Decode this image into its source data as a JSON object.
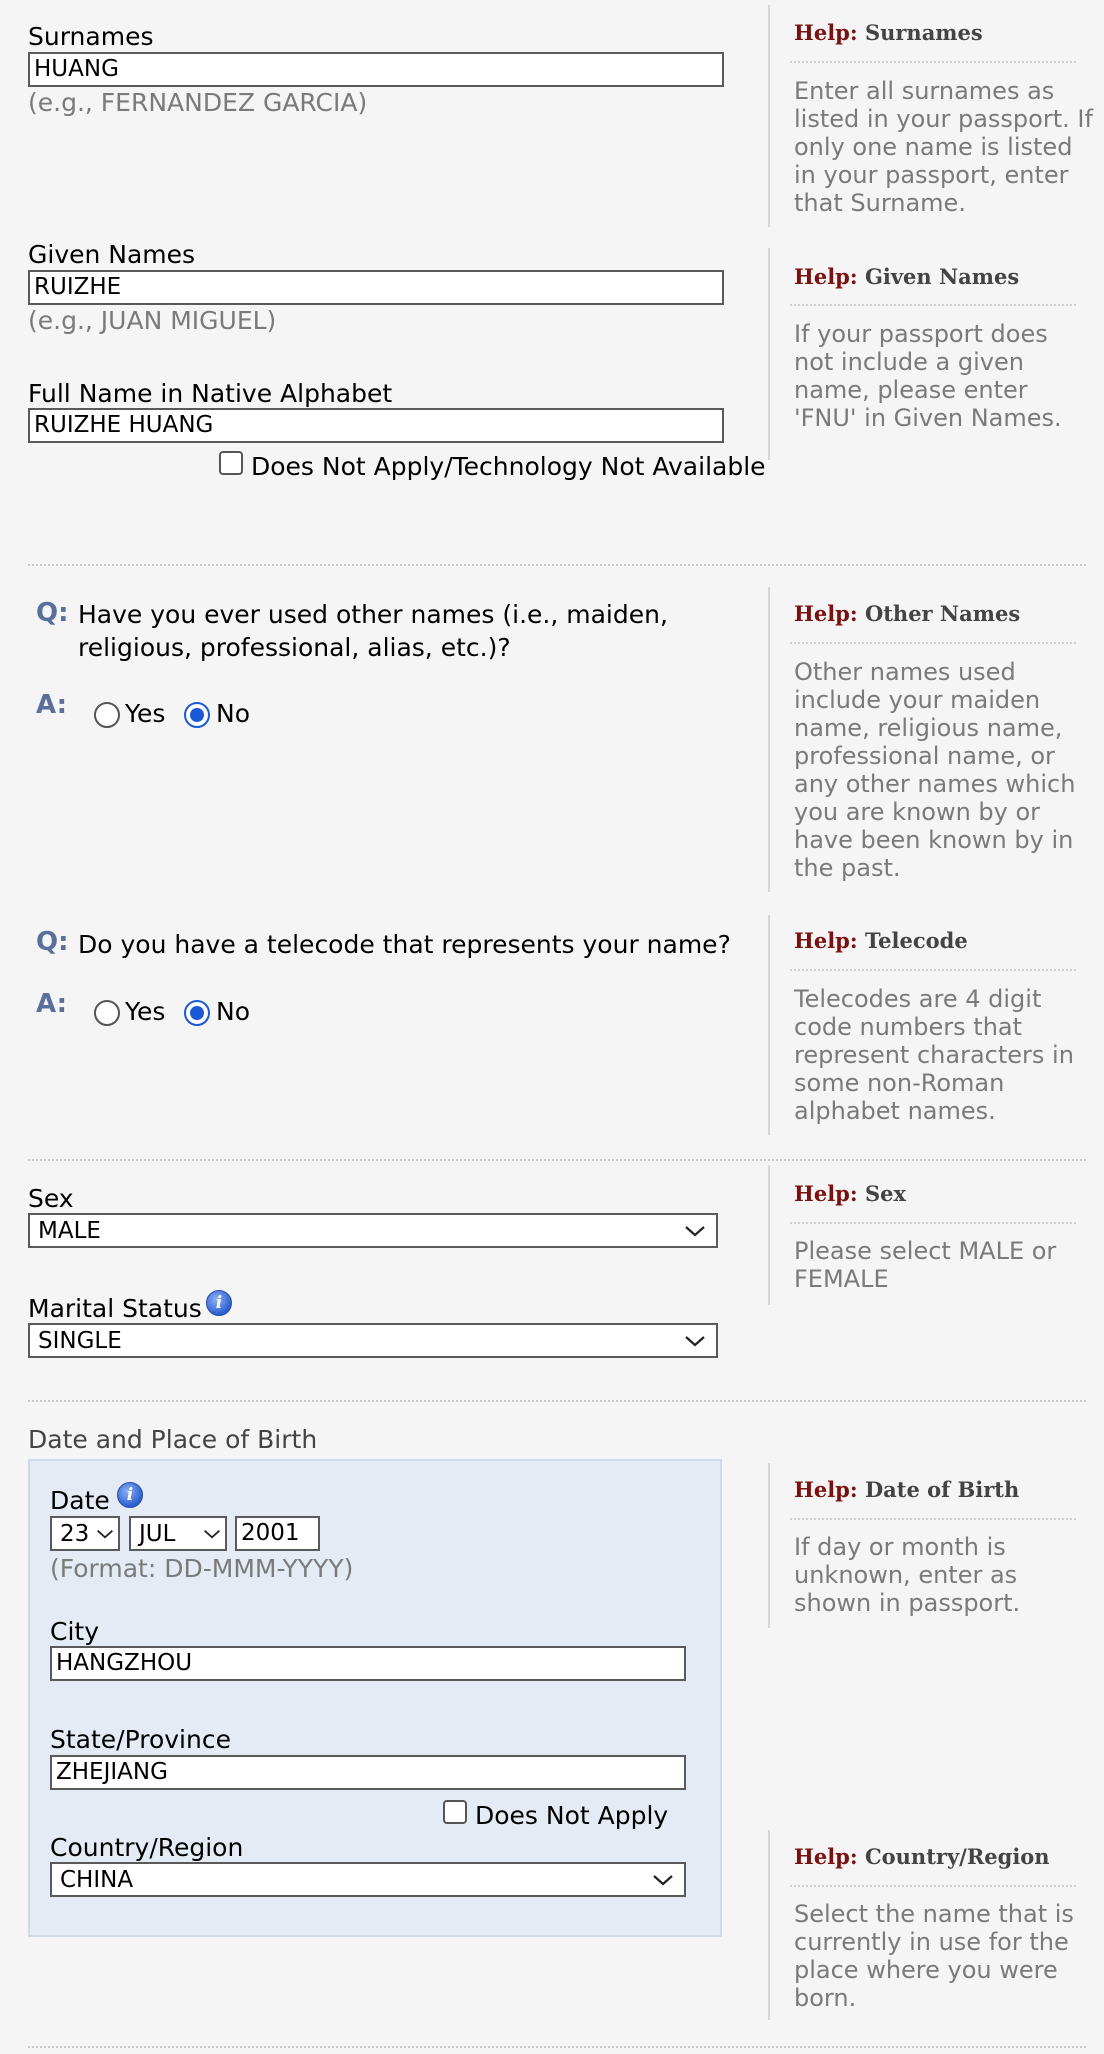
{
  "names": {
    "surnames": {
      "label": "Surnames",
      "value": "HUANG",
      "example": "(e.g., FERNANDEZ GARCIA)"
    },
    "given_names": {
      "label": "Given Names",
      "value": "RUIZHE",
      "example": "(e.g., JUAN MIGUEL)"
    },
    "native_name": {
      "label": "Full Name in Native Alphabet",
      "value": "RUIZHE HUANG",
      "na_label": "Does Not Apply/Technology Not Available",
      "na_checked": false
    }
  },
  "questions": {
    "q_marker": "Q:",
    "a_marker": "A:",
    "other_names": {
      "question": "Have you ever used other names (i.e., maiden, religious, professional, alias, etc.)?",
      "yes": "Yes",
      "no": "No",
      "selected": "No"
    },
    "telecode": {
      "question": "Do you have a telecode that represents your name?",
      "yes": "Yes",
      "no": "No",
      "selected": "No"
    }
  },
  "personal": {
    "sex": {
      "label": "Sex",
      "value": "MALE"
    },
    "marital": {
      "label": "Marital Status",
      "value": "SINGLE"
    }
  },
  "birth": {
    "section_title": "Date and Place of Birth",
    "date_label": "Date",
    "day": "23",
    "month": "JUL",
    "year": "2001",
    "format_hint": "(Format: DD-MMM-YYYY)",
    "city": {
      "label": "City",
      "value": "HANGZHOU"
    },
    "state": {
      "label": "State/Province",
      "value": "ZHEJIANG",
      "na_label": "Does Not Apply",
      "na_checked": false
    },
    "country": {
      "label": "Country/Region",
      "value": "CHINA"
    }
  },
  "help": {
    "prefix": "Help:",
    "surnames": {
      "title": "Surnames",
      "body": "Enter all surnames as listed in your passport. If only one name is listed in your passport, enter that Surname."
    },
    "given_names": {
      "title": "Given Names",
      "body": "If your passport does not include a given name, please enter 'FNU' in Given Names."
    },
    "other_names": {
      "title": "Other Names",
      "body": "Other names used include your maiden name, religious name, professional name, or any other names which you are known by or have been known by in the past."
    },
    "telecode": {
      "title": "Telecode",
      "body": "Telecodes are 4 digit code numbers that represent characters in some non-Roman alphabet names."
    },
    "sex": {
      "title": "Sex",
      "body": "Please select MALE or FEMALE"
    },
    "dob": {
      "title": "Date of Birth",
      "body": "If day or month is unknown, enter as shown in passport."
    },
    "country": {
      "title": "Country/Region",
      "body": "Select the name that is currently in use for the place where you were born."
    }
  },
  "colors": {
    "help_prefix": "#7a1111",
    "qa_marker": "#5b6f9c",
    "radio_selected": "#1a5ad6",
    "birth_panel": "#e4ebf5"
  },
  "icons": {
    "select": "chevron-down-icon",
    "info": "info-icon"
  }
}
